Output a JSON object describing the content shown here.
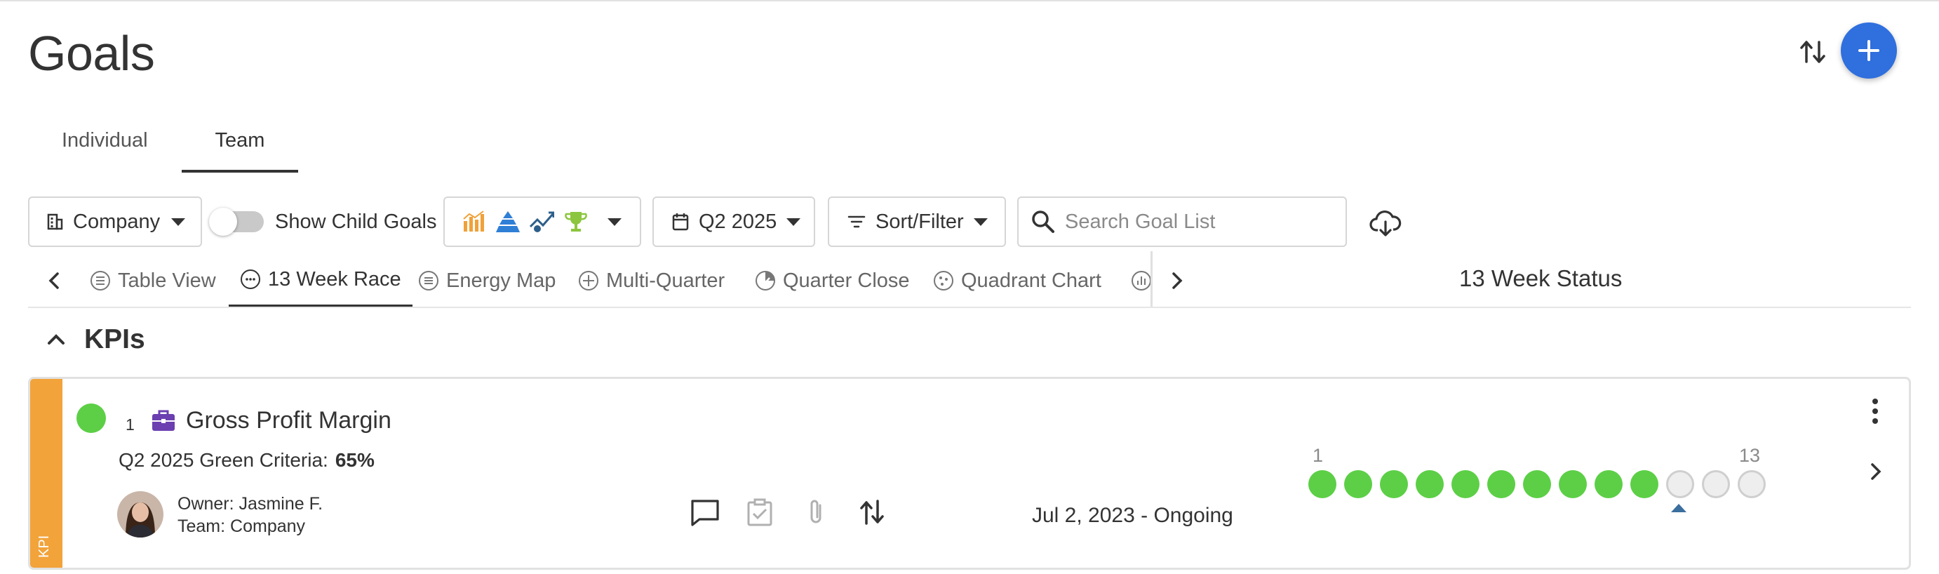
{
  "page": {
    "title": "Goals"
  },
  "header": {
    "swap_icon": "swap-vertical-icon",
    "add_icon": "plus-icon",
    "add_color": "#2f6fde"
  },
  "tabs": [
    {
      "label": "Individual",
      "active": false
    },
    {
      "label": "Team",
      "active": true
    }
  ],
  "toolbar": {
    "scope": {
      "label": "Company",
      "icon": "building-icon"
    },
    "show_child_goals": {
      "label": "Show Child Goals",
      "on": false
    },
    "goal_types": {
      "icons": [
        "bar-chart-icon",
        "pyramid-icon",
        "trend-line-icon",
        "trophy-icon"
      ]
    },
    "quarter": {
      "label": "Q2 2025",
      "icon": "calendar-icon"
    },
    "sort_filter": {
      "label": "Sort/Filter",
      "icon": "filter-icon"
    },
    "search": {
      "placeholder": "Search Goal List",
      "value": ""
    },
    "export_icon": "cloud-download-icon"
  },
  "views": {
    "items": [
      {
        "label": "Table View",
        "icon": "table-icon",
        "active": false
      },
      {
        "label": "13 Week Race",
        "icon": "race-icon",
        "active": true
      },
      {
        "label": "Energy Map",
        "icon": "energy-map-icon",
        "active": false
      },
      {
        "label": "Multi-Quarter",
        "icon": "multi-quarter-icon",
        "active": false
      },
      {
        "label": "Quarter Close",
        "icon": "quarter-close-icon",
        "active": false
      },
      {
        "label": "Quadrant Chart",
        "icon": "quadrant-icon",
        "active": false
      }
    ],
    "status_header": "13 Week Status"
  },
  "section": {
    "title": "KPIs"
  },
  "goal": {
    "band_label": "KPI",
    "band_color": "#f2a33a",
    "status_color": "#5ccf46",
    "number": "1",
    "name": "Gross Profit Margin",
    "criteria_label": "Q2 2025 Green Criteria:",
    "criteria_value": "65%",
    "owner_label": "Owner:",
    "owner": "Jasmine F.",
    "team_label": "Team:",
    "team": "Company",
    "date_range": "Jul 2, 2023 - Ongoing",
    "week_start": "1",
    "week_end": "13",
    "weeks": [
      "green",
      "green",
      "green",
      "green",
      "green",
      "green",
      "green",
      "green",
      "green",
      "green",
      "empty",
      "empty",
      "empty"
    ],
    "current_week": 11
  }
}
